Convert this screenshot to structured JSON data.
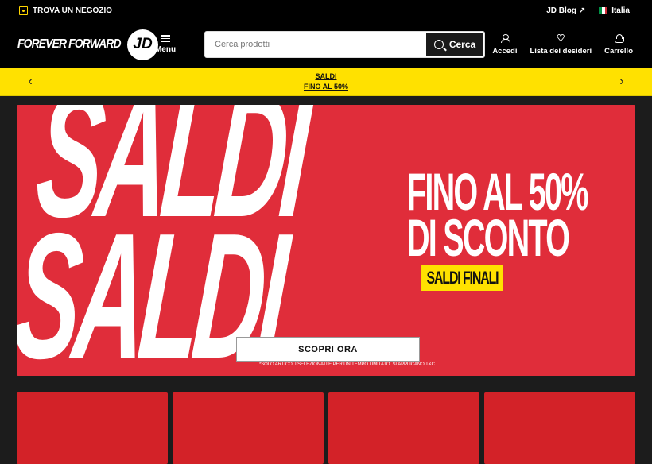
{
  "topbar": {
    "store_locator": "TROVA UN NEGOZIO",
    "blog": "JD Blog",
    "country": "Italia"
  },
  "header": {
    "logo_text": "FOREVER FORWARD",
    "logo_mark": "JD",
    "menu_label": "Menu",
    "search_placeholder": "Cerca prodotti",
    "search_button": "Cerca",
    "actions": {
      "account": "Accedi",
      "wishlist": "Lista dei desideri",
      "cart": "Carrello"
    }
  },
  "promo_bar": {
    "line1": "SALDI",
    "line2": "FINO AL 50%"
  },
  "hero": {
    "big_word": "SALDI",
    "headline_line1": "FINO AL 50%",
    "headline_line2": "DI SCONTO",
    "badge": "SALDI FINALI",
    "cta": "SCOPRI ORA",
    "disclaimer": "*SOLO ARTICOLI SELEZIONATI E PER UN TEMPO LIMITATO. SI APPLICANO T&C."
  },
  "colors": {
    "accent_yellow": "#ffe100",
    "hero_red": "#e02d3a",
    "tile_red": "#d32228"
  }
}
